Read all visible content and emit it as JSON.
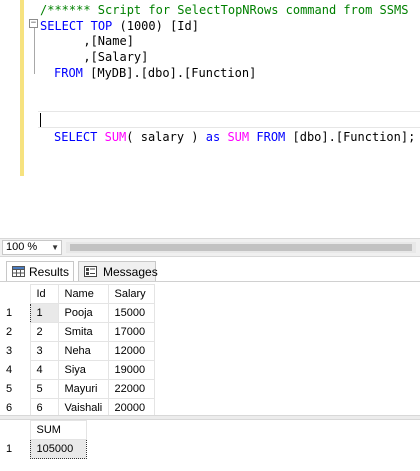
{
  "editor": {
    "comment": "/****** Script for SelectTopNRows command from SSMS  ******/",
    "line1": {
      "kw_select": "SELECT",
      "kw_top": "TOP",
      "rest": " (1000) [Id]"
    },
    "line2": "      ,[Name]",
    "line3": "      ,[Salary]",
    "line4": {
      "kw_from": "FROM",
      "rest": " [MyDB].[dbo].[Function]"
    },
    "line5": {
      "kw_select": "SELECT",
      "fn_sum": "SUM",
      "mid": "( salary ) ",
      "kw_as": "as",
      "fn_sum2": "SUM",
      "kw_from": "FROM",
      "rest": " [dbo].[Function];"
    }
  },
  "zoom": {
    "value": "100 %"
  },
  "tabs": {
    "results": "Results",
    "messages": "Messages"
  },
  "results": {
    "headers": [
      "Id",
      "Name",
      "Salary"
    ],
    "rows": [
      {
        "num": "1",
        "id": "1",
        "name": "Pooja",
        "salary": "15000"
      },
      {
        "num": "2",
        "id": "2",
        "name": "Smita",
        "salary": "17000"
      },
      {
        "num": "3",
        "id": "3",
        "name": "Neha",
        "salary": "12000"
      },
      {
        "num": "4",
        "id": "4",
        "name": "Siya",
        "salary": "19000"
      },
      {
        "num": "5",
        "id": "5",
        "name": "Mayuri",
        "salary": "22000"
      },
      {
        "num": "6",
        "id": "6",
        "name": "Vaishali",
        "salary": "20000"
      }
    ]
  },
  "sum_result": {
    "header": "SUM",
    "row_num": "1",
    "value": "105000"
  },
  "colors": {
    "keyword": "#0000ff",
    "function": "#ff00ff",
    "comment": "#008000",
    "change_bar": "#f6e27f"
  }
}
